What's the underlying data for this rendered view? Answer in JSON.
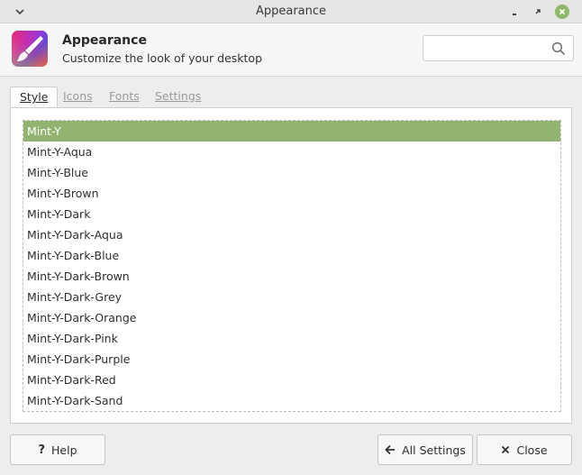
{
  "window": {
    "title": "Appearance"
  },
  "header": {
    "app_title": "Appearance",
    "subtitle": "Customize the look of your desktop",
    "search": {
      "value": "",
      "placeholder": ""
    }
  },
  "tabs": [
    {
      "label": "Style",
      "active": true
    },
    {
      "label": "Icons",
      "active": false
    },
    {
      "label": "Fonts",
      "active": false
    },
    {
      "label": "Settings",
      "active": false
    }
  ],
  "themes": [
    "Mint-Y",
    "Mint-Y-Aqua",
    "Mint-Y-Blue",
    "Mint-Y-Brown",
    "Mint-Y-Dark",
    "Mint-Y-Dark-Aqua",
    "Mint-Y-Dark-Blue",
    "Mint-Y-Dark-Brown",
    "Mint-Y-Dark-Grey",
    "Mint-Y-Dark-Orange",
    "Mint-Y-Dark-Pink",
    "Mint-Y-Dark-Purple",
    "Mint-Y-Dark-Red",
    "Mint-Y-Dark-Sand"
  ],
  "selected_theme": "Mint-Y",
  "buttons": {
    "help": "Help",
    "all_settings": "All Settings",
    "close": "Close"
  },
  "icons": {
    "menu": "chevron-down-icon",
    "minimize": "minimize-icon",
    "maximize": "restore-icon",
    "close": "close-icon",
    "app": "paintbrush-icon",
    "search": "search-icon",
    "help": "question-icon",
    "back": "arrow-left-icon",
    "close_button": "x-icon"
  },
  "colors": {
    "selection": "#92b372",
    "accent_close": "#8fb86b"
  }
}
